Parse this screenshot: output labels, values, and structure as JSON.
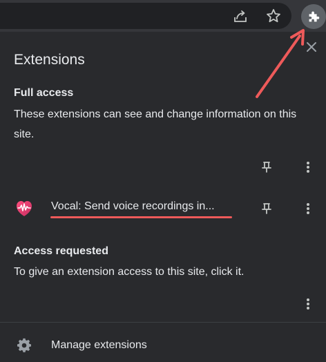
{
  "toolbar": {
    "share_icon": "share-icon",
    "star_icon": "star-icon",
    "extensions_icon": "puzzle-icon"
  },
  "panel": {
    "title": "Extensions",
    "close_icon": "close-icon"
  },
  "full_access": {
    "heading": "Full access",
    "description": "These extensions can see and change information on this site."
  },
  "extensions": [
    {
      "name": "Vocal: Send voice recordings in...",
      "icon": "vocal-logo"
    }
  ],
  "access_requested": {
    "heading": "Access requested",
    "description": "To give an extension access to this site, click it."
  },
  "footer": {
    "manage_label": "Manage extensions",
    "manage_icon": "gear-icon"
  },
  "colors": {
    "background": "#292a2d",
    "toolbar": "#35363a",
    "text": "#e8eaed",
    "annotation": "#ee5a5a",
    "icon": "#9aa0a6"
  }
}
